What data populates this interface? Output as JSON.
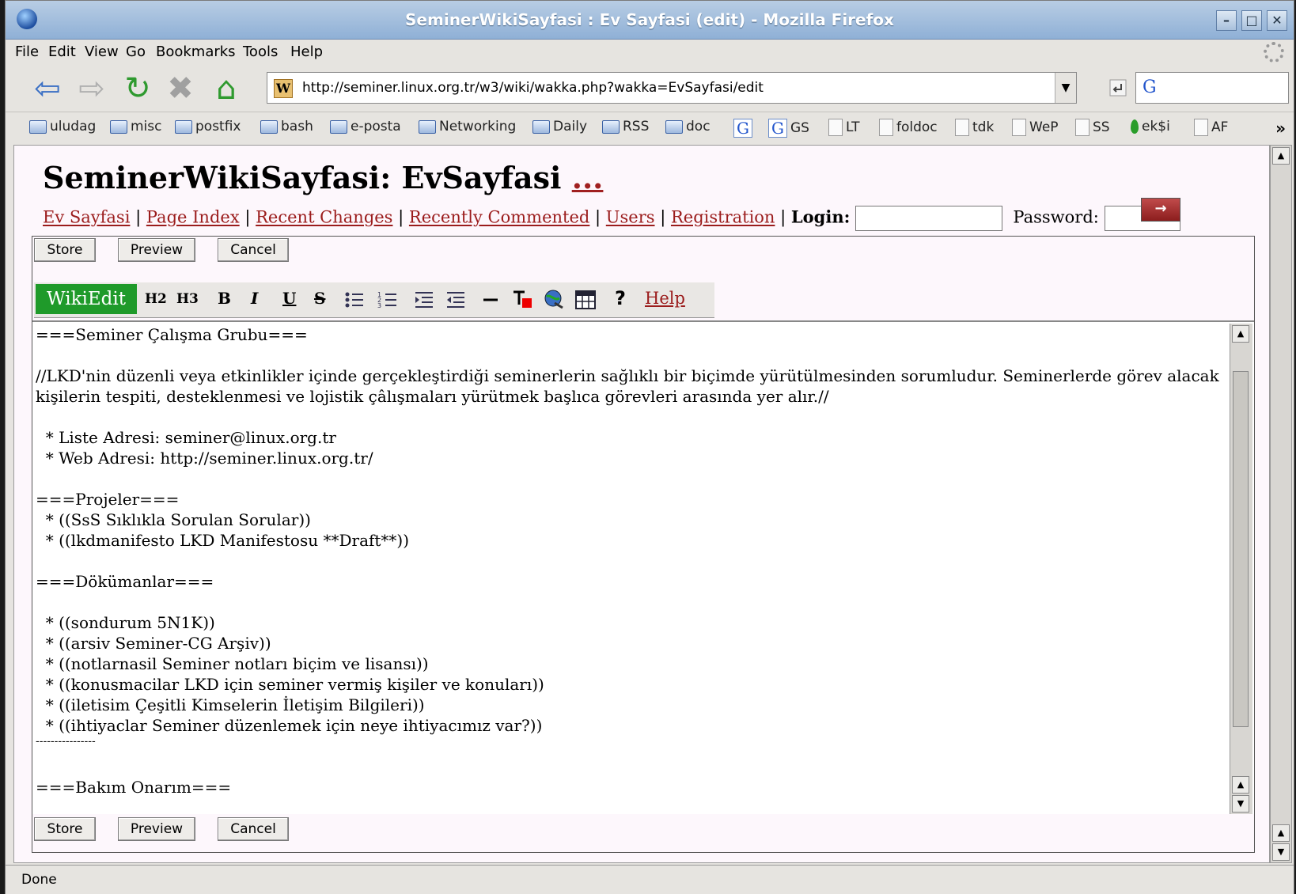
{
  "window": {
    "title": "SeminerWikiSayfasi : Ev Sayfasi (edit) - Mozilla Firefox",
    "controls": [
      "–",
      "□",
      "✕"
    ]
  },
  "menu": [
    "File",
    "Edit",
    "View",
    "Go",
    "Bookmarks",
    "Tools",
    "Help"
  ],
  "navbar": {
    "url": "http://seminer.linux.org.tr/w3/wiki/wakka.php?wakka=EvSayfasi/edit",
    "favicon_letter": "W",
    "search_engine_letter": "G"
  },
  "bookmarks": [
    {
      "label": "uludag",
      "icon": "folder-icon"
    },
    {
      "label": "misc",
      "icon": "folder-icon"
    },
    {
      "label": "postfix",
      "icon": "folder-icon"
    },
    {
      "label": "bash",
      "icon": "folder-icon"
    },
    {
      "label": "e-posta",
      "icon": "folder-icon"
    },
    {
      "label": "Networking",
      "icon": "folder-icon"
    },
    {
      "label": "Daily",
      "icon": "folder-icon"
    },
    {
      "label": "RSS",
      "icon": "folder-icon"
    },
    {
      "label": "doc",
      "icon": "folder-icon"
    },
    {
      "label": "",
      "icon": "google-icon"
    },
    {
      "label": "GS",
      "icon": "google-icon"
    },
    {
      "label": "LT",
      "icon": "page-icon"
    },
    {
      "label": "foldoc",
      "icon": "page-icon"
    },
    {
      "label": "tdk",
      "icon": "page-icon"
    },
    {
      "label": "WeP",
      "icon": "page-icon"
    },
    {
      "label": "SS",
      "icon": "page-icon"
    },
    {
      "label": "ek$i",
      "icon": "drop-icon"
    },
    {
      "label": "AF",
      "icon": "page-icon"
    }
  ],
  "page": {
    "title": "SeminerWikiSayfasi: EvSayfasi",
    "title_more": "...",
    "links": [
      "Ev Sayfasi",
      "Page Index",
      "Recent Changes",
      "Recently Commented",
      "Users",
      "Registration"
    ],
    "login_label": "Login:",
    "password_label": "Password:",
    "login_button": "→"
  },
  "editor": {
    "store": "Store",
    "preview": "Preview",
    "cancel": "Cancel",
    "wikiedit": "WikiEdit",
    "toolbar": {
      "h2": "H2",
      "h3": "H3",
      "bold": "B",
      "italic": "I",
      "underline": "U",
      "strike": "S",
      "help_q": "?",
      "help": "Help"
    },
    "lines": [
      "===Seminer Çalışma Grubu===",
      "",
      "//LKD'nin düzenli veya etkinlikler içinde gerçekleştirdiği seminerlerin sağlıklı bir biçimde yürütülmesinden sorumludur. Seminerlerde görev alacak",
      "kişilerin tespiti, desteklenmesi ve lojistik çâlışmaları yürütmek başlıca görevleri arasında yer alır.//",
      "",
      "  * Liste Adresi: seminer@linux.org.tr",
      "  * Web Adresi: http://seminer.linux.org.tr/",
      "",
      "===Projeler===",
      "  * ((SsS Sıklıkla Sorulan Sorular))",
      "  * ((lkdmanifesto LKD Manifestosu **Draft**))",
      "",
      "===Dökümanlar===",
      "",
      "  * ((sondurum 5N1K))",
      "  * ((arsiv Seminer-CG Arşiv))",
      "  * ((notlarnasil Seminer notları biçim ve lisansı))",
      "  * ((konusmacilar LKD için seminer vermiş kişiler ve konuları))",
      "  * ((iletisim Çeşitli Kimselerin İletişim Bilgileri))",
      "  * ((ihtiyaclar Seminer düzenlemek için neye ihtiyacımız var?))",
      "----------------",
      "",
      "===Bakım Onarım==="
    ]
  },
  "status": "Done"
}
